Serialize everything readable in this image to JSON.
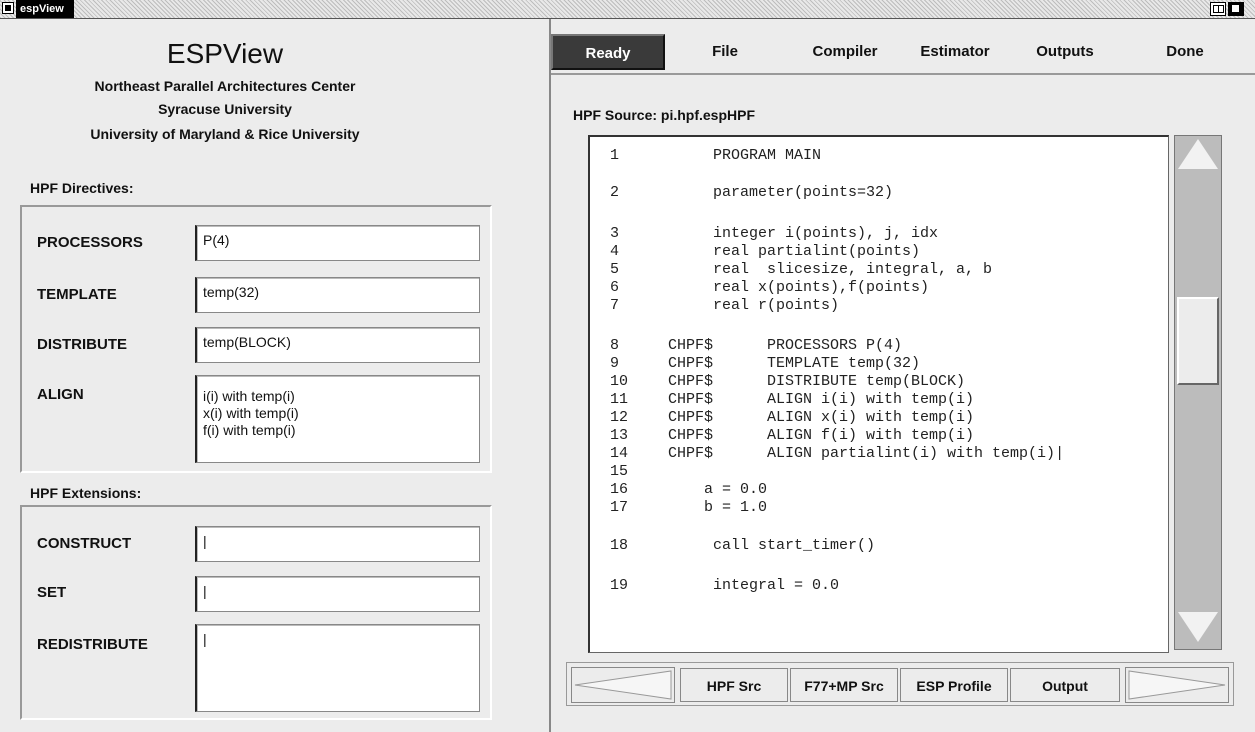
{
  "window": {
    "title": "espView"
  },
  "header": {
    "title": "ESPView",
    "lines": [
      "Northeast Parallel Architectures Center",
      "Syracuse University",
      "University of Maryland & Rice University"
    ]
  },
  "directives": {
    "section_label": "HPF Directives:",
    "processors": {
      "label": "PROCESSORS",
      "value": "P(4)"
    },
    "template": {
      "label": "TEMPLATE",
      "value": "temp(32)"
    },
    "distribute": {
      "label": "DISTRIBUTE",
      "value": "temp(BLOCK)"
    },
    "align": {
      "label": "ALIGN",
      "value": "i(i) with temp(i)\nx(i) with temp(i)\nf(i) with temp(i)"
    }
  },
  "extensions": {
    "section_label": "HPF Extensions:",
    "construct": {
      "label": "CONSTRUCT",
      "value": "|"
    },
    "set": {
      "label": "SET",
      "value": "|"
    },
    "redistribute": {
      "label": "REDISTRIBUTE",
      "value": "|"
    }
  },
  "menu": {
    "ready": "Ready",
    "file": "File",
    "compiler": "Compiler",
    "estimator": "Estimator",
    "outputs": "Outputs",
    "done": "Done"
  },
  "source": {
    "label": "HPF Source: pi.hpf.espHPF",
    "lines": [
      {
        "n": "1",
        "t": "     PROGRAM MAIN"
      },
      {
        "n": "2",
        "t": "     parameter(points=32)"
      },
      {
        "n": "3",
        "t": "     integer i(points), j, idx"
      },
      {
        "n": "4",
        "t": "     real partialint(points)"
      },
      {
        "n": "5",
        "t": "     real  slicesize, integral, a, b"
      },
      {
        "n": "6",
        "t": "     real x(points),f(points)"
      },
      {
        "n": "7",
        "t": "     real r(points)"
      },
      {
        "n": "8",
        "t": "CHPF$      PROCESSORS P(4)"
      },
      {
        "n": "9",
        "t": "CHPF$      TEMPLATE temp(32)"
      },
      {
        "n": "10",
        "t": "CHPF$      DISTRIBUTE temp(BLOCK)"
      },
      {
        "n": "11",
        "t": "CHPF$      ALIGN i(i) with temp(i)"
      },
      {
        "n": "12",
        "t": "CHPF$      ALIGN x(i) with temp(i)"
      },
      {
        "n": "13",
        "t": "CHPF$      ALIGN f(i) with temp(i)"
      },
      {
        "n": "14",
        "t": "CHPF$      ALIGN partialint(i) with temp(i)|"
      },
      {
        "n": "15",
        "t": ""
      },
      {
        "n": "16",
        "t": "    a = 0.0"
      },
      {
        "n": "17",
        "t": "    b = 1.0"
      },
      {
        "n": "18",
        "t": "     call start_timer()"
      },
      {
        "n": "19",
        "t": "     integral = 0.0"
      }
    ]
  },
  "tabs": {
    "hpf_src": "HPF Src",
    "f77_src": "F77+MP Src",
    "esp_profile": "ESP Profile",
    "output": "Output"
  }
}
